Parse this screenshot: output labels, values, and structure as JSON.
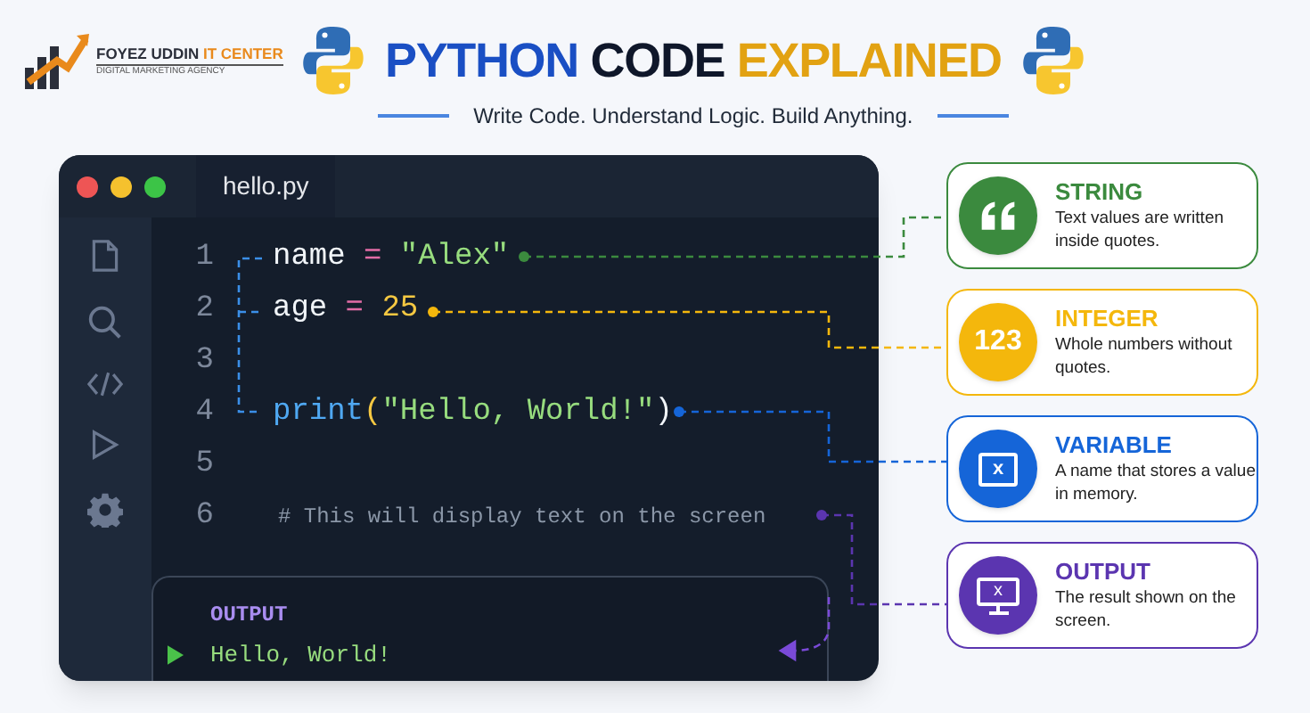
{
  "logo": {
    "name": "FOYEZ UDDIN",
    "accent": "IT CENTER",
    "tagline": "DIGITAL MARKETING AGENCY"
  },
  "title": [
    {
      "text": "PYTHON",
      "color": "#1a4fc4"
    },
    {
      "text": "CODE",
      "color": "#0f172a"
    },
    {
      "text": "EXPLAINED",
      "color": "#e2a212"
    }
  ],
  "subtitle": "Write Code. Understand Logic. Build Anything.",
  "editor": {
    "filename": "hello.py",
    "lines": [
      {
        "number": "1",
        "tokens": [
          {
            "text": "name",
            "kind": "ident"
          },
          {
            "text": " = ",
            "kind": "op"
          },
          {
            "text": "\"Alex\"",
            "kind": "string"
          }
        ]
      },
      {
        "number": "2",
        "tokens": [
          {
            "text": "age",
            "kind": "ident"
          },
          {
            "text": " = ",
            "kind": "op"
          },
          {
            "text": "25",
            "kind": "number"
          }
        ]
      },
      {
        "number": "3"
      },
      {
        "number": "4",
        "tokens": [
          {
            "text": "print",
            "kind": "func"
          },
          {
            "text": "(",
            "kind": "paren"
          },
          {
            "text": "\"Hello, World!\"",
            "kind": "string"
          },
          {
            "text": ")",
            "kind": "ident"
          }
        ]
      },
      {
        "number": "5"
      },
      {
        "number": "6",
        "tokens": [
          {
            "text": "# This will display text on the screen",
            "kind": "comment"
          }
        ]
      }
    ],
    "output": {
      "label": "OUTPUT",
      "text": "Hello, World!"
    }
  },
  "cards": [
    {
      "kind": "quote",
      "title": "STRING",
      "description": "Text values are written inside quotes.",
      "color": "#3b8a3e"
    },
    {
      "kind": "number",
      "icon_text": "123",
      "title": "INTEGER",
      "description": "Whole numbers without quotes.",
      "color": "#f4b70c"
    },
    {
      "kind": "variable",
      "icon_text": "x",
      "title": "VARIABLE",
      "description": "A name that stores a value in memory.",
      "color": "#1565d8"
    },
    {
      "kind": "screen",
      "icon_text": "x",
      "title": "OUTPUT",
      "description": "The result shown on the screen.",
      "color": "#5b35b0"
    }
  ]
}
